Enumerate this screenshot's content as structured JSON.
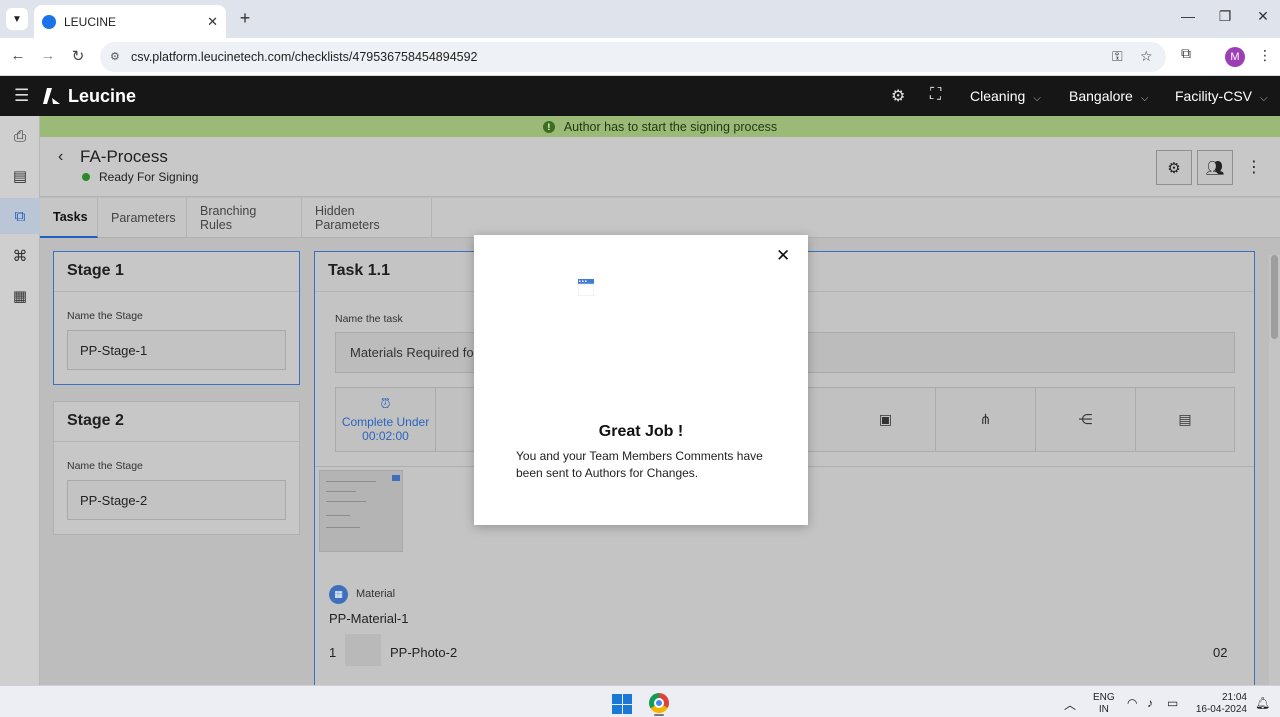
{
  "browser": {
    "tab_title": "LEUCINE",
    "url": "csv.platform.leucinetech.com/checklists/479536758454894592",
    "profile_initial": "M"
  },
  "app": {
    "logo_text": "Leucine",
    "header_selects": [
      {
        "label": "Cleaning"
      },
      {
        "label": "Bangalore"
      },
      {
        "label": "Facility-CSV"
      }
    ]
  },
  "banner": {
    "text": "Author has to start the signing process",
    "color": "#9bba78"
  },
  "page": {
    "title": "FA-Process",
    "status": "Ready For Signing",
    "status_color": "#2a8a2a"
  },
  "tabs": [
    {
      "label": "Tasks",
      "active": true
    },
    {
      "label": "Parameters"
    },
    {
      "label": "Branching Rules"
    },
    {
      "label": "Hidden Parameters"
    }
  ],
  "stages": [
    {
      "title": "Stage 1",
      "field_label": "Name the Stage",
      "value": "PP-Stage-1"
    },
    {
      "title": "Stage 2",
      "field_label": "Name the Stage",
      "value": "PP-Stage-2"
    }
  ],
  "task": {
    "title": "Task 1.1",
    "field_label": "Name the task",
    "value": "Materials Required for",
    "timer_label": "Complete Under",
    "timer_value": "00:02:00",
    "material_label": "Material",
    "material_name": "PP-Material-1",
    "material_index": "1",
    "material_photo": "PP-Photo-2",
    "material_qty": "02"
  },
  "modal": {
    "title": "Great Job !",
    "text": "You and your Team Members Comments have been sent to Authors for Changes."
  },
  "taskbar": {
    "lang_top": "ENG",
    "lang_bottom": "IN",
    "time": "21:04",
    "date": "16-04-2024"
  },
  "colors": {
    "accent": "#1f5fbf",
    "appbar": "#161616"
  }
}
